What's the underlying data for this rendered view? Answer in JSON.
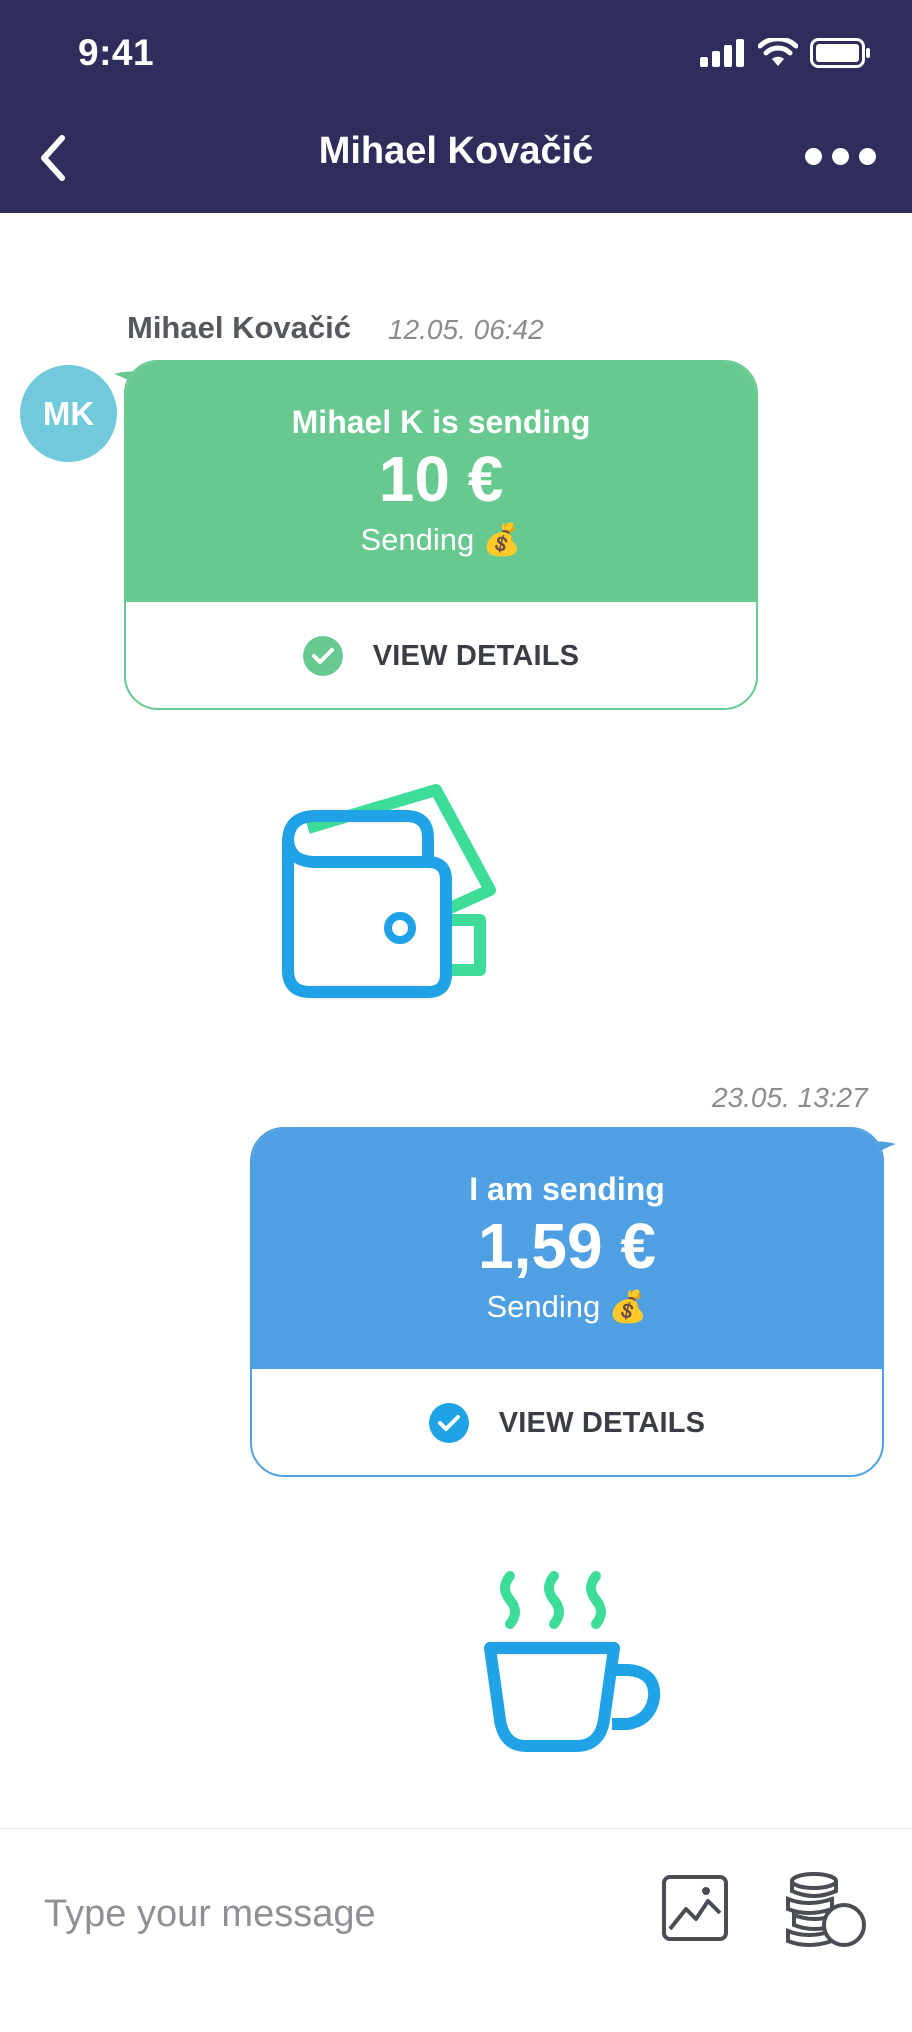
{
  "status_bar": {
    "time": "9:41"
  },
  "nav": {
    "title": "Mihael Kovačić"
  },
  "messages": [
    {
      "sender": "Mihael Kovačić",
      "timestamp": "12.05.  06:42",
      "avatar_initials": "MK",
      "title": "Mihael K is sending",
      "amount": "10  €",
      "status": "Sending 💰",
      "action": "VIEW DETAILS",
      "color": "#68c990",
      "sticker": "wallet-icon"
    },
    {
      "timestamp": "23.05.  13:27",
      "title": "I am sending",
      "amount": "1,59  €",
      "status": "Sending 💰",
      "action": "VIEW DETAILS",
      "color": "#4f9fe3",
      "sticker": "coffee-cup-icon"
    }
  ],
  "composer": {
    "placeholder": "Type your message"
  }
}
